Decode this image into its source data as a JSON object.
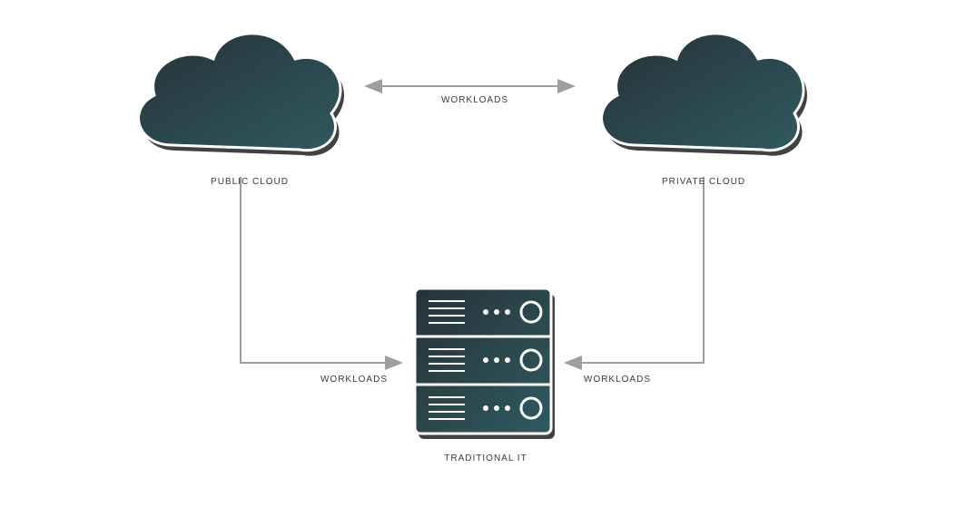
{
  "nodes": {
    "public_cloud": {
      "label": "PUBLIC CLOUD"
    },
    "private_cloud": {
      "label": "PRIVATE CLOUD"
    },
    "traditional_it": {
      "label": "TRADITIONAL IT"
    }
  },
  "edges": {
    "top": {
      "label": "WORKLOADS"
    },
    "left": {
      "label": "WORKLOADS"
    },
    "right": {
      "label": "WORKLOADS"
    }
  },
  "colors": {
    "fill_dark": "#263238",
    "fill_teal": "#2f5a5f",
    "stroke": "#ffffff",
    "shadow": "#2c2c2c",
    "arrow": "#9e9e9e",
    "text": "#3a3a3a"
  }
}
